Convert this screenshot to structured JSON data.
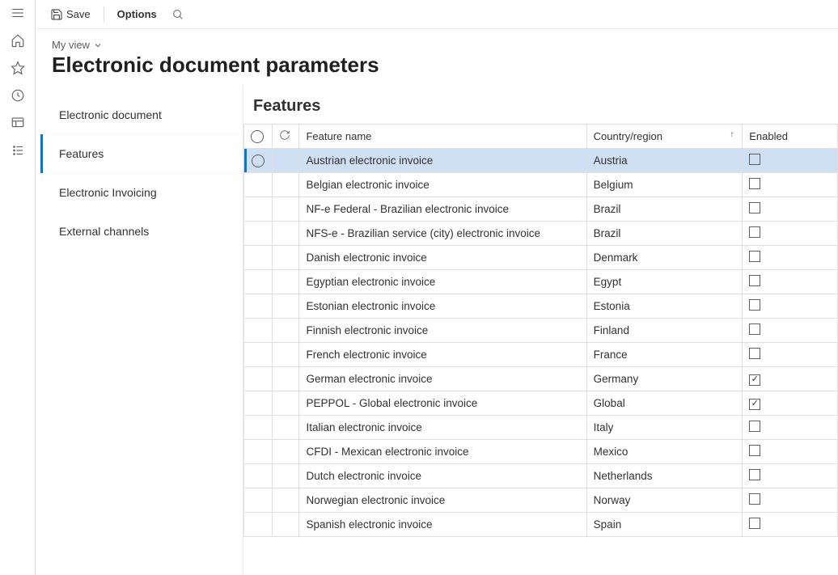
{
  "toolbar": {
    "save_label": "Save",
    "options_label": "Options"
  },
  "header": {
    "view_label": "My view",
    "page_title": "Electronic document parameters"
  },
  "sections": {
    "items": [
      {
        "label": "Electronic document",
        "active": false
      },
      {
        "label": "Features",
        "active": true
      },
      {
        "label": "Electronic Invoicing",
        "active": false
      },
      {
        "label": "External channels",
        "active": false
      }
    ]
  },
  "panel": {
    "title": "Features",
    "columns": {
      "feature_name": "Feature name",
      "country_region": "Country/region",
      "enabled": "Enabled"
    },
    "rows": [
      {
        "name": "Austrian electronic invoice",
        "country": "Austria",
        "enabled": false,
        "selected": true
      },
      {
        "name": "Belgian electronic invoice",
        "country": "Belgium",
        "enabled": false,
        "selected": false
      },
      {
        "name": "NF-e  Federal - Brazilian electronic invoice",
        "country": "Brazil",
        "enabled": false,
        "selected": false
      },
      {
        "name": "NFS-e - Brazilian service (city) electronic invoice",
        "country": "Brazil",
        "enabled": false,
        "selected": false
      },
      {
        "name": "Danish electronic invoice",
        "country": "Denmark",
        "enabled": false,
        "selected": false
      },
      {
        "name": "Egyptian electronic invoice",
        "country": "Egypt",
        "enabled": false,
        "selected": false
      },
      {
        "name": "Estonian electronic invoice",
        "country": "Estonia",
        "enabled": false,
        "selected": false
      },
      {
        "name": "Finnish electronic invoice",
        "country": "Finland",
        "enabled": false,
        "selected": false
      },
      {
        "name": "French electronic invoice",
        "country": "France",
        "enabled": false,
        "selected": false
      },
      {
        "name": "German electronic invoice",
        "country": "Germany",
        "enabled": true,
        "selected": false
      },
      {
        "name": "PEPPOL - Global electronic invoice",
        "country": "Global",
        "enabled": true,
        "selected": false
      },
      {
        "name": "Italian electronic invoice",
        "country": "Italy",
        "enabled": false,
        "selected": false
      },
      {
        "name": "CFDI - Mexican electronic invoice",
        "country": "Mexico",
        "enabled": false,
        "selected": false
      },
      {
        "name": "Dutch electronic invoice",
        "country": "Netherlands",
        "enabled": false,
        "selected": false
      },
      {
        "name": "Norwegian electronic invoice",
        "country": "Norway",
        "enabled": false,
        "selected": false
      },
      {
        "name": "Spanish electronic invoice",
        "country": "Spain",
        "enabled": false,
        "selected": false
      }
    ]
  }
}
